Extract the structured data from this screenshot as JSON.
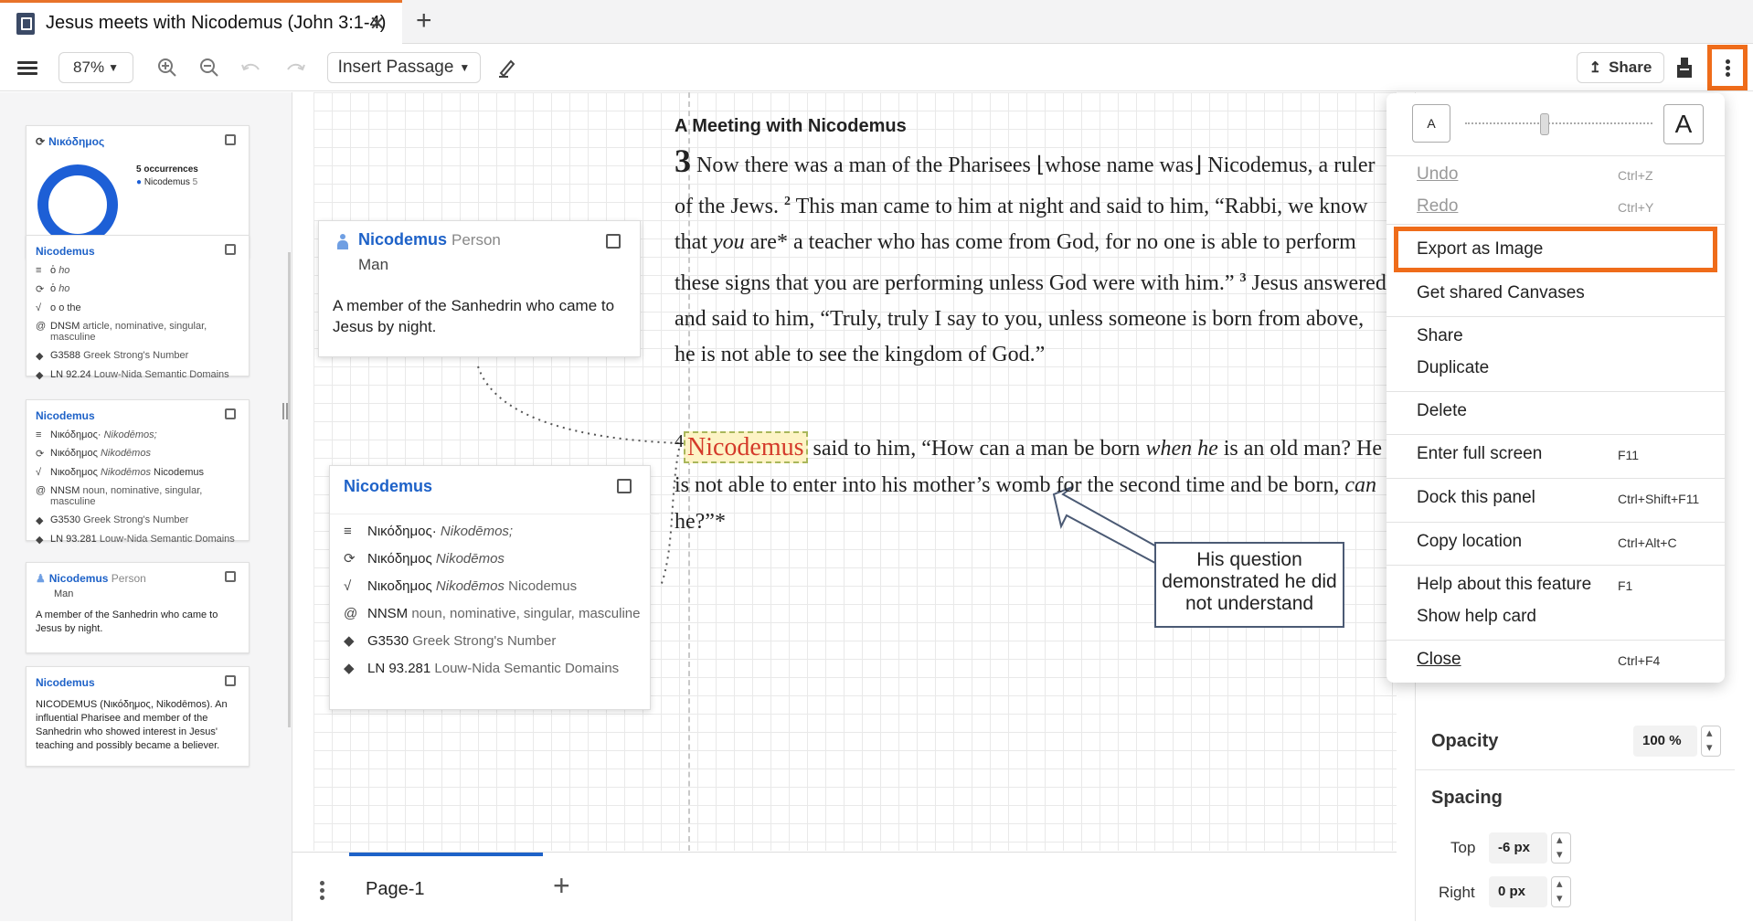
{
  "tab": {
    "title": "Jesus meets with Nicodemus (John 3:1-4)",
    "close": "✕",
    "add": "+"
  },
  "toolbar": {
    "zoom": "87%",
    "insert_passage": "Insert Passage",
    "share": "Share"
  },
  "sidebar": {
    "occ_card": {
      "title": "Νικόδημος",
      "count": "5 occurrences",
      "legend": "Nicodemus",
      "legend_count": "5"
    },
    "card2": {
      "title": "Nicodemus",
      "rows": [
        {
          "greek": "ὁ",
          "translit": "ho",
          "extra": ""
        },
        {
          "greek": "ὁ",
          "translit": "ho",
          "extra": ""
        },
        {
          "greek": "o",
          "translit": "o",
          "extra": "the"
        },
        {
          "greek": "DNSM",
          "translit": "",
          "extra": "article, nominative, singular, masculine"
        },
        {
          "greek": "G3588",
          "translit": "",
          "extra": "Greek Strong's Number"
        },
        {
          "greek": "LN 92.24",
          "translit": "",
          "extra": "Louw-Nida Semantic Domains"
        }
      ]
    },
    "card3": {
      "title": "Nicodemus",
      "rows": [
        {
          "greek": "Νικόδημος·",
          "translit": "Nikodēmos;",
          "extra": ""
        },
        {
          "greek": "Νικόδημος",
          "translit": "Nikodēmos",
          "extra": ""
        },
        {
          "greek": "Νικοδημος",
          "translit": "Nikodēmos",
          "extra": "Nicodemus"
        },
        {
          "greek": "NNSM",
          "translit": "",
          "extra": "noun, nominative, singular, masculine"
        },
        {
          "greek": "G3530",
          "translit": "",
          "extra": "Greek Strong's Number"
        },
        {
          "greek": "LN 93.281",
          "translit": "",
          "extra": "Louw-Nida Semantic Domains"
        }
      ]
    },
    "card4": {
      "title": "Nicodemus",
      "type": "Person",
      "sub": "Man",
      "body": "A member of the Sanhedrin who came to Jesus by night."
    },
    "card5": {
      "title": "Nicodemus",
      "body": "NICODEMUS (Νικόδημος, Nikodēmos). An influential Pharisee and member of the Sanhedrin who showed interest in Jesus' teaching and possibly became a believer."
    }
  },
  "canvas": {
    "heading": "A Meeting with Nicodemus",
    "chapter": "3",
    "verse1": "Now there was a man of the Pharisees ⌊whose name was⌋ Nicodemus, a ruler of the Jews.",
    "v2_num": "2",
    "verse2": "This man came to him at night and said to him, “Rabbi, we know that",
    "verse2_em": "you",
    "verse2b": "are* a teacher who has come from God, for no one is able to perform these signs that you are performing unless God were with him.”",
    "v3_num": "3",
    "verse3": "Jesus answered and said to him, “Truly, truly I say to you, unless someone is born from above, he is not able to see the kingdom of God.”",
    "v4_num": "4",
    "v4_word": "Nicodemus",
    "verse4a": "said to him, “How can a man be born",
    "verse4_em": "when he",
    "verse4b": "is an old man? He is not able to enter into his mother’s womb for the second time and be born,",
    "verse4_em2": "can",
    "verse4c": "he?”*",
    "note1": {
      "title": "Nicodemus",
      "type": "Person",
      "sub": "Man",
      "body": "A member of the Sanhedrin who came to Jesus by night."
    },
    "note2": {
      "title": "Nicodemus",
      "rows": [
        {
          "a": "Νικόδημος·",
          "b": "Nikodēmos;",
          "c": ""
        },
        {
          "a": "Νικόδημος",
          "b": "Nikodēmos",
          "c": ""
        },
        {
          "a": "Νικοδημος",
          "b": "Nikodēmos",
          "c": "Nicodemus"
        },
        {
          "a": "NNSM",
          "b": "",
          "c": "noun, nominative, singular, masculine"
        },
        {
          "a": "G3530",
          "b": "",
          "c": "Greek Strong's Number"
        },
        {
          "a": "LN 93.281",
          "b": "",
          "c": "Louw-Nida Semantic Domains"
        }
      ]
    },
    "callout": "His question demonstrated he did not understand"
  },
  "pagebar": {
    "page_tab": "Page-1",
    "add": "+"
  },
  "right_panel": {
    "opacity_label": "Opacity",
    "opacity_value": "100 %",
    "spacing_label": "Spacing",
    "top_label": "Top",
    "top_value": "-6 px",
    "right_label": "Right",
    "right_value": "0 px"
  },
  "menu": {
    "font_small": "A",
    "font_large": "A",
    "items": [
      {
        "label": "Undo",
        "shortcut": "Ctrl+Z",
        "disabled": true
      },
      {
        "label": "Redo",
        "shortcut": "Ctrl+Y",
        "disabled": true
      },
      {
        "label": "Export as Image",
        "shortcut": "",
        "disabled": false
      },
      {
        "label": "Get shared Canvases",
        "shortcut": "",
        "disabled": false
      },
      {
        "label": "Share",
        "shortcut": "",
        "disabled": false
      },
      {
        "label": "Duplicate",
        "shortcut": "",
        "disabled": false
      },
      {
        "label": "Delete",
        "shortcut": "",
        "disabled": false
      },
      {
        "label": "Enter full screen",
        "shortcut": "F11",
        "disabled": false
      },
      {
        "label": "Dock this panel",
        "shortcut": "Ctrl+Shift+F11",
        "disabled": false
      },
      {
        "label": "Copy location",
        "shortcut": "Ctrl+Alt+C",
        "disabled": false
      },
      {
        "label": "Help about this feature",
        "shortcut": "F1",
        "disabled": false
      },
      {
        "label": "Show help card",
        "shortcut": "",
        "disabled": false
      },
      {
        "label": "Close",
        "shortcut": "Ctrl+F4",
        "disabled": false
      }
    ]
  },
  "colors": {
    "accent_orange": "#ef6c1a",
    "link_blue": "#1e62c8",
    "highlight_red": "#d43a2a"
  }
}
